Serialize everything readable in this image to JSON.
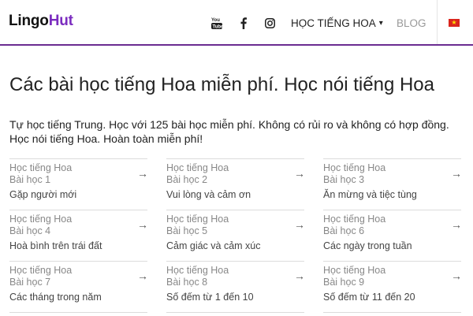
{
  "header": {
    "logo_main": "Lingo",
    "logo_accent": "Hut",
    "social_icons": [
      "youtube-icon",
      "facebook-icon",
      "instagram-icon"
    ],
    "menu_label": "HỌC TIẾNG HOA",
    "menu_caret": "▾",
    "blog_label": "BLOG",
    "language_flag": "vietnam-flag",
    "accent_color": "#6a2c91"
  },
  "main": {
    "title": "Các bài học tiếng Hoa miễn phí. Học nói tiếng Hoa",
    "intro_line1": "Tự học tiếng Trung. Học với 125 bài học miễn phí. Không có rủi ro và không có hợp đồng.",
    "intro_line2": "Học nói tiếng Hoa. Hoàn toàn miễn phí!",
    "lessons": [
      {
        "course": "Học tiếng Hoa",
        "lesson": "Bài học 1",
        "topic": "Gặp người mới"
      },
      {
        "course": "Học tiếng Hoa",
        "lesson": "Bài học 2",
        "topic": "Vui lòng và cảm ơn"
      },
      {
        "course": "Học tiếng Hoa",
        "lesson": "Bài học 3",
        "topic": "Ăn mừng và tiệc tùng"
      },
      {
        "course": "Học tiếng Hoa",
        "lesson": "Bài học 4",
        "topic": "Hoà bình trên trái đất"
      },
      {
        "course": "Học tiếng Hoa",
        "lesson": "Bài học 5",
        "topic": "Cảm giác và cảm xúc"
      },
      {
        "course": "Học tiếng Hoa",
        "lesson": "Bài học 6",
        "topic": "Các ngày trong tuần"
      },
      {
        "course": "Học tiếng Hoa",
        "lesson": "Bài học 7",
        "topic": "Các tháng trong năm"
      },
      {
        "course": "Học tiếng Hoa",
        "lesson": "Bài học 8",
        "topic": "Số đếm từ 1 đến 10"
      },
      {
        "course": "Học tiếng Hoa",
        "lesson": "Bài học 9",
        "topic": "Số đếm từ 11 đến 20"
      }
    ],
    "arrow_glyph": "→"
  }
}
